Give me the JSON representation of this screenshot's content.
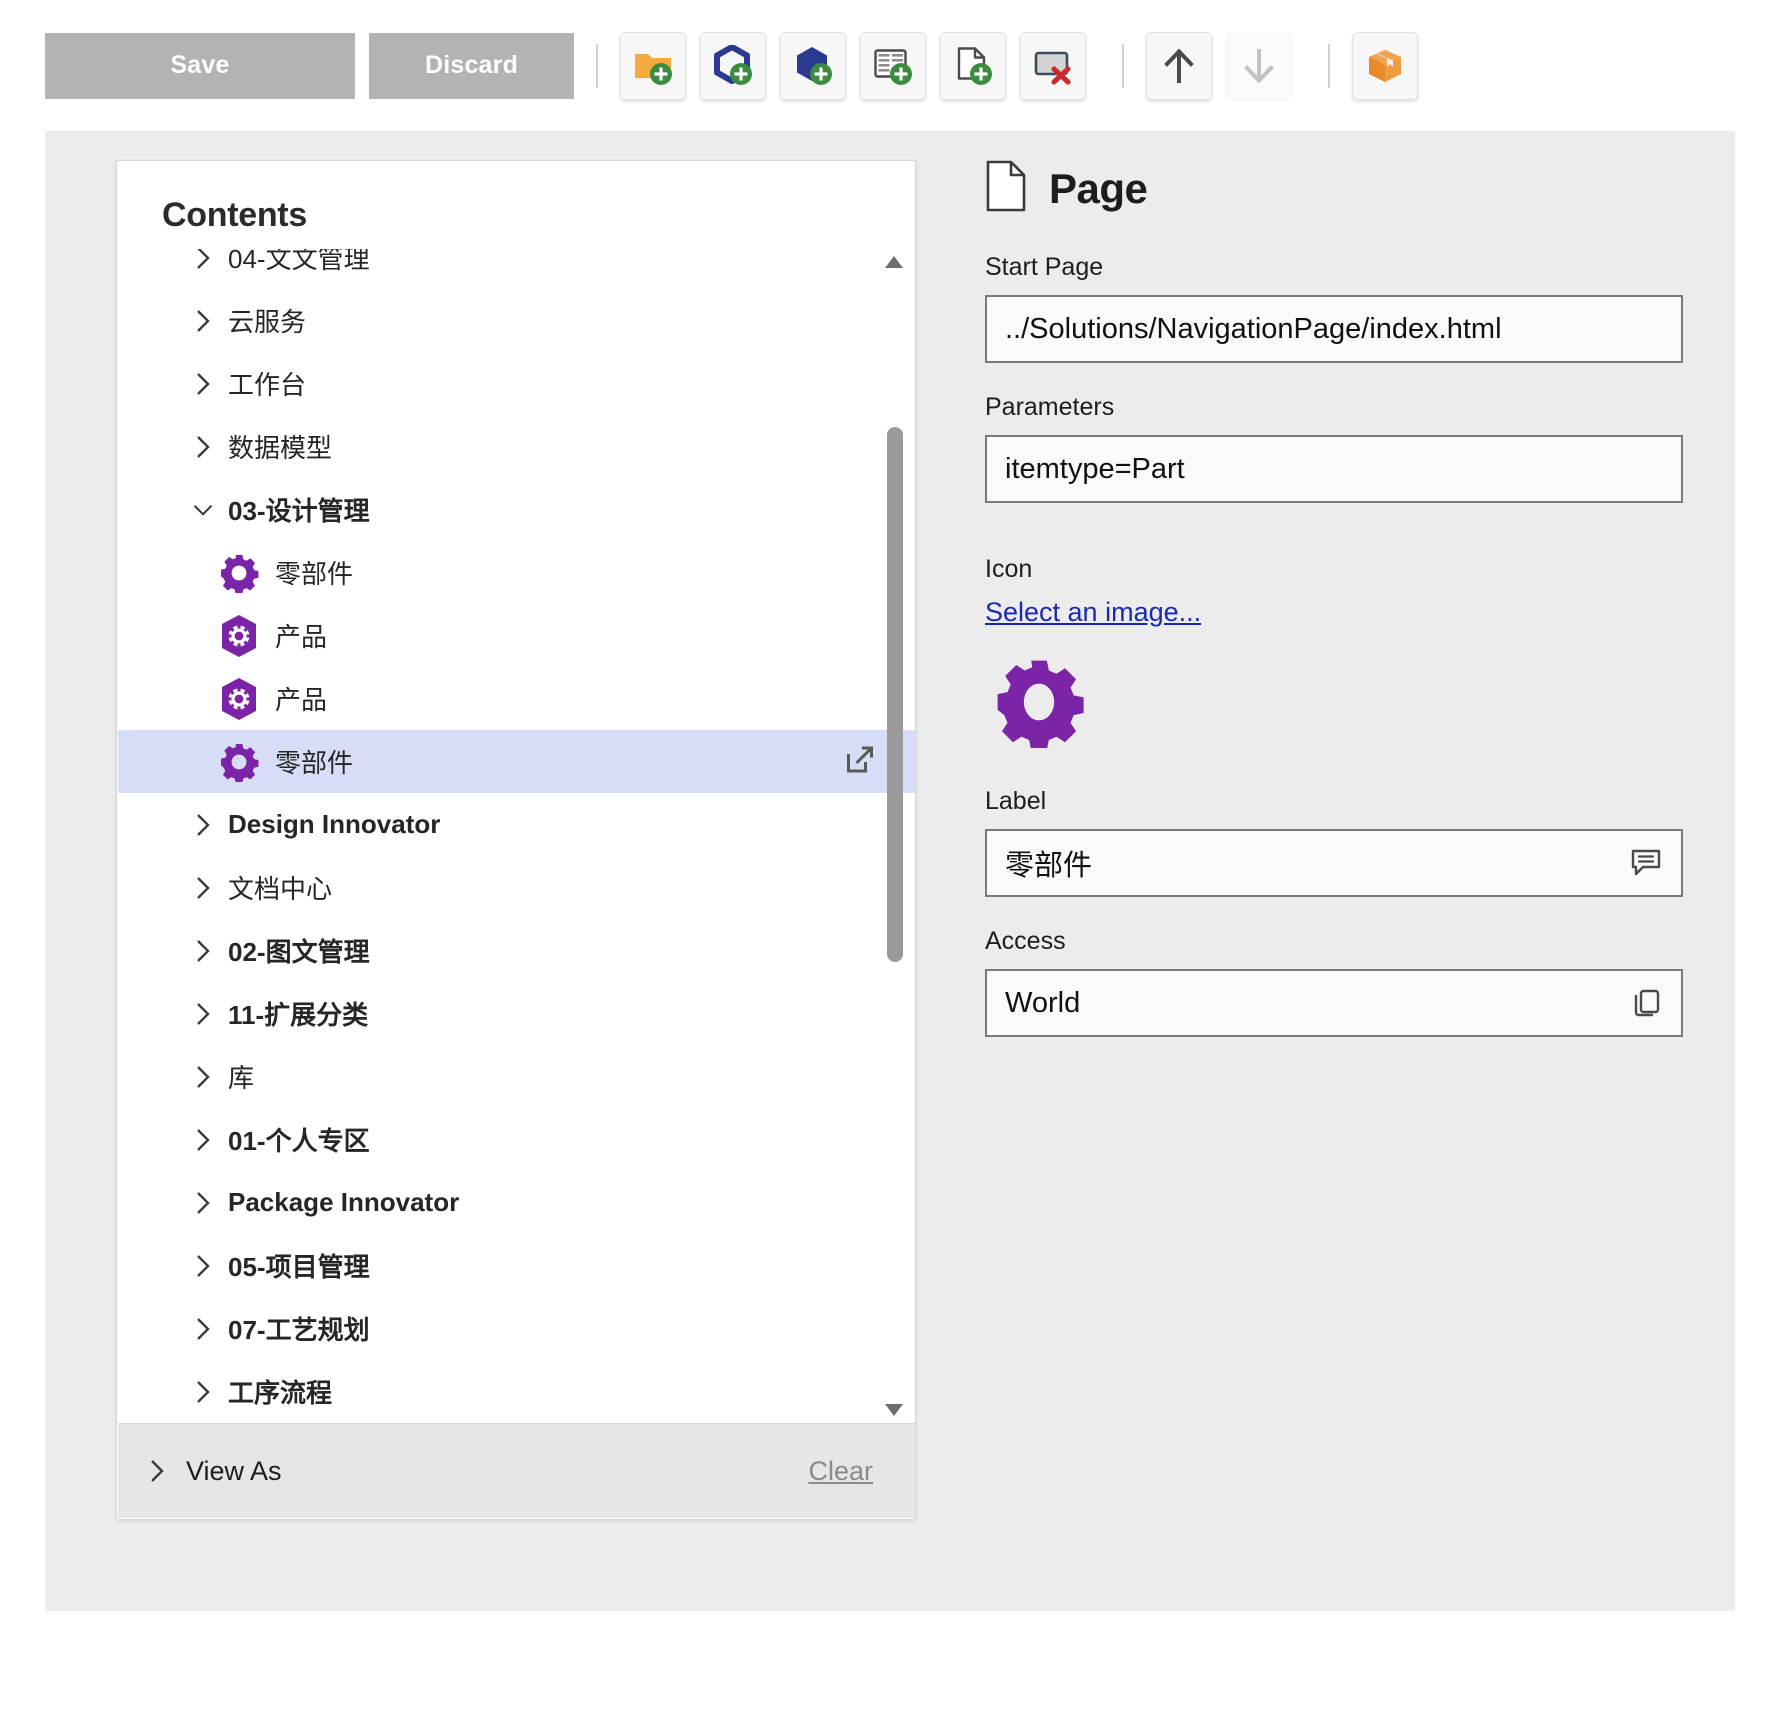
{
  "toolbar": {
    "save_label": "Save",
    "discard_label": "Discard",
    "buttons": [
      {
        "name": "new-folder-button",
        "icon": "folder-add-icon"
      },
      {
        "name": "new-item-outline-button",
        "icon": "hexagon-outline-add-icon"
      },
      {
        "name": "new-item-solid-button",
        "icon": "hexagon-solid-add-icon"
      },
      {
        "name": "new-form-button",
        "icon": "form-add-icon"
      },
      {
        "name": "new-page-button",
        "icon": "page-add-icon"
      },
      {
        "name": "delete-item-button",
        "icon": "panel-delete-icon"
      },
      {
        "name": "move-up-button",
        "icon": "arrow-up-icon"
      },
      {
        "name": "move-down-button",
        "icon": "arrow-down-icon"
      },
      {
        "name": "package-button",
        "icon": "package-box-icon"
      }
    ]
  },
  "contents": {
    "title": "Contents",
    "tree": [
      {
        "label": "04-文文管理",
        "chevron": "right",
        "level": 1,
        "type": "group",
        "clipped": true
      },
      {
        "label": "云服务",
        "chevron": "right",
        "level": 1,
        "type": "group"
      },
      {
        "label": "工作台",
        "chevron": "right",
        "level": 1,
        "type": "group"
      },
      {
        "label": "数据模型",
        "chevron": "right",
        "level": 1,
        "type": "group"
      },
      {
        "label": "03-设计管理",
        "chevron": "down",
        "level": 1,
        "type": "group",
        "bold": true
      },
      {
        "label": "零部件",
        "level": 2,
        "type": "leaf",
        "icon": "gear-icon"
      },
      {
        "label": "产品",
        "level": 2,
        "type": "leaf",
        "icon": "hex-gear-icon"
      },
      {
        "label": "产品",
        "level": 2,
        "type": "leaf",
        "icon": "hex-gear-icon"
      },
      {
        "label": "零部件",
        "level": 2,
        "type": "leaf",
        "icon": "gear-icon",
        "selected": true,
        "trailing_icon": "external-link-icon"
      },
      {
        "label": "Design Innovator",
        "chevron": "right",
        "level": 1,
        "type": "group",
        "bold": true
      },
      {
        "label": "文档中心",
        "chevron": "right",
        "level": 1,
        "type": "group"
      },
      {
        "label": "02-图文管理",
        "chevron": "right",
        "level": 1,
        "type": "group"
      },
      {
        "label": "11-扩展分类",
        "chevron": "right",
        "level": 1,
        "type": "group"
      },
      {
        "label": "库",
        "chevron": "right",
        "level": 1,
        "type": "group"
      },
      {
        "label": "01-个人专区",
        "chevron": "right",
        "level": 1,
        "type": "group"
      },
      {
        "label": "Package Innovator",
        "chevron": "right",
        "level": 1,
        "type": "group",
        "bold": true
      },
      {
        "label": "05-项目管理",
        "chevron": "right",
        "level": 1,
        "type": "group"
      },
      {
        "label": "07-工艺规划",
        "chevron": "right",
        "level": 1,
        "type": "group"
      },
      {
        "label": "工序流程",
        "chevron": "right",
        "level": 1,
        "type": "group"
      }
    ],
    "view_as_label": "View As",
    "clear_label": "Clear"
  },
  "properties": {
    "title": "Page",
    "start_page": {
      "label": "Start Page",
      "value": "../Solutions/NavigationPage/index.html"
    },
    "parameters": {
      "label": "Parameters",
      "value": "itemtype=Part"
    },
    "icon": {
      "label": "Icon",
      "link_label": "Select an image...",
      "preview_icon": "gear-icon"
    },
    "label_field": {
      "label": "Label",
      "value": "零部件",
      "trailing_icon": "translate-icon"
    },
    "access_field": {
      "label": "Access",
      "value": "World",
      "trailing_icon": "copy-icon"
    }
  },
  "colors": {
    "accent_purple": "#7B24A8",
    "selection": "#d7ddf6",
    "link_blue": "#1a2ab0",
    "button_gray": "#b3b3b3",
    "panel_bg": "#ececec"
  }
}
